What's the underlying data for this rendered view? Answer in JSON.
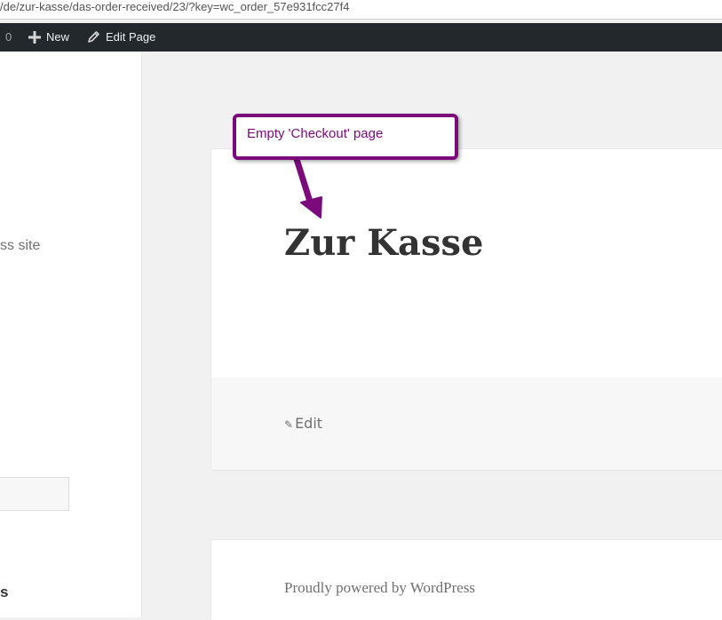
{
  "browser": {
    "url": "/de/zur-kasse/das-order-received/23/?key=wc_order_57e931fcc27f4"
  },
  "admin_bar": {
    "comment_count": "0",
    "new_label": "New",
    "edit_page_label": "Edit Page",
    "icons": {
      "new": "plus-icon",
      "edit": "pencil-icon"
    }
  },
  "sidebar": {
    "description_fragment": "ss site",
    "heading_fragment": "s"
  },
  "page": {
    "title": "Zur Kasse",
    "edit_label": "Edit"
  },
  "footer": {
    "credit": "Proudly powered by WordPress"
  },
  "annotation": {
    "text": "Empty 'Checkout' page",
    "color": "#7b0b7b"
  },
  "colors": {
    "admin_bar_bg": "#23282d",
    "page_bg": "#f1f1f1",
    "annotation": "#7b0b7b"
  }
}
